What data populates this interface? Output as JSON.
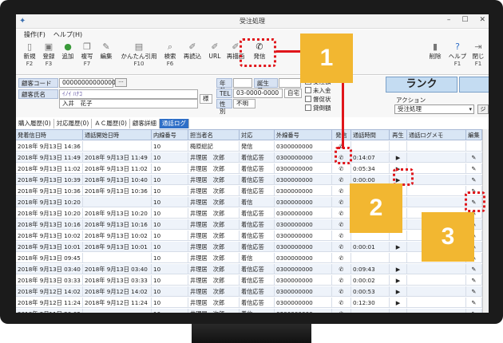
{
  "window": {
    "title": "受注処理",
    "controls": [
      "–",
      "☐",
      "✕"
    ]
  },
  "menu": {
    "items": [
      "操作(F)",
      "ヘルプ(H)"
    ]
  },
  "toolbar": {
    "buttons": [
      {
        "label": "新規",
        "key": "F2",
        "icon": "new-document-icon"
      },
      {
        "label": "登録",
        "key": "F3",
        "icon": "save-icon"
      },
      {
        "label": "追加",
        "key": "",
        "icon": "add-icon"
      },
      {
        "label": "複写",
        "key": "F7",
        "icon": "copy-icon"
      },
      {
        "label": "編集",
        "key": "",
        "icon": "edit-icon"
      },
      {
        "label": "かんたん引用",
        "key": "F10",
        "icon": "quote-icon"
      },
      {
        "label": "検索",
        "key": "F6",
        "icon": "search-icon"
      },
      {
        "label": "再読込",
        "key": "",
        "icon": "reload-icon"
      },
      {
        "label": "URL",
        "key": "",
        "icon": "link-icon"
      },
      {
        "label": "再描画",
        "key": "",
        "icon": "redraw-icon"
      },
      {
        "label": "発信",
        "key": "",
        "icon": "phone-icon"
      },
      {
        "label": "削除",
        "key": "",
        "icon": "delete-icon"
      },
      {
        "label": "ヘルプ",
        "key": "F1",
        "icon": "help-icon"
      },
      {
        "label": "閉じ",
        "key": "F1",
        "icon": "close-icon"
      }
    ]
  },
  "customer": {
    "code_label": "顧客コード",
    "code_value": "000000000000002",
    "code_btn": "···",
    "name_label": "顧客氏名",
    "kana": "ｲﾉｲ ﾊﾅｺ",
    "name": "入井　花子",
    "honorific": "様",
    "age_label": "年齢",
    "birth_label": "誕生月",
    "tel_label": "TEL",
    "tel_value": "03-0000-0000",
    "tel_kind": "自宅",
    "sex_label": "性別",
    "sex_value": "不明",
    "checks": [
      "受注額",
      "未入金",
      "督促状",
      "貸倒額"
    ],
    "rank_label": "ランク",
    "action_label": "アクション",
    "action_value": "受注処理",
    "action_btn": "ジ"
  },
  "tabs": [
    "購入履歴(0)",
    "対応履歴(0)",
    "ＡＣ履歴(0)",
    "顧客詳細",
    "通話ログ"
  ],
  "table": {
    "headers": [
      "発着信日時",
      "通話開始日時",
      "内線番号",
      "担当者名",
      "対応",
      "外線番号",
      "発信",
      "通話時間",
      "再生",
      "通話ログメモ",
      "編集"
    ],
    "rows": [
      [
        "2018年 9月13日 14:36",
        "",
        "10",
        "梅原総記",
        "発信",
        "0300000000",
        "",
        "",
        "",
        "",
        ""
      ],
      [
        "2018年 9月13日 11:49",
        "2018年 9月13日 11:49",
        "10",
        "井理居　次郎",
        "着信応答",
        "0300000000",
        "",
        "0:14:07",
        "▶",
        "",
        "✎"
      ],
      [
        "2018年 9月13日 11:02",
        "2018年 9月13日 11:02",
        "10",
        "井理居　次郎",
        "着信応答",
        "0300000000",
        "",
        "0:05:34",
        "▶",
        "",
        "✎"
      ],
      [
        "2018年 9月13日 10:39",
        "2018年 9月13日 10:40",
        "10",
        "井理居　次郎",
        "着信応答",
        "0300000000",
        "",
        "0:00:00",
        "▶",
        "",
        "✎"
      ],
      [
        "2018年 9月13日 10:36",
        "2018年 9月13日 10:36",
        "10",
        "井理居　次郎",
        "着信応答",
        "0300000000",
        "",
        "",
        "▶",
        "",
        "✎"
      ],
      [
        "2018年 9月13日 10:20",
        "",
        "10",
        "井理居　次郎",
        "着信",
        "0300000000",
        "",
        "",
        "",
        "",
        "✎"
      ],
      [
        "2018年 9月13日 10:20",
        "2018年 9月13日 10:20",
        "10",
        "井理居　次郎",
        "着信応答",
        "0300000000",
        "",
        "",
        "",
        "",
        "✎"
      ],
      [
        "2018年 9月13日 10:16",
        "2018年 9月13日 10:16",
        "10",
        "井理居　次郎",
        "着信応答",
        "0300000000",
        "",
        "",
        "",
        "",
        "✎"
      ],
      [
        "2018年 9月13日 10:02",
        "2018年 9月13日 10:02",
        "10",
        "井理居　次郎",
        "着信応答",
        "0300000000",
        "",
        "",
        "",
        "",
        "✎"
      ],
      [
        "2018年 9月13日 10:01",
        "2018年 9月13日 10:01",
        "10",
        "井理居　次郎",
        "着信応答",
        "0300000000",
        "",
        "0:00:01",
        "▶",
        "",
        "✎"
      ],
      [
        "2018年 9月13日 09:45",
        "",
        "10",
        "井理居　次郎",
        "着信",
        "0300000000",
        "",
        "",
        "",
        "",
        "✎"
      ],
      [
        "2018年 9月13日 03:40",
        "2018年 9月13日 03:40",
        "10",
        "井理居　次郎",
        "着信応答",
        "0300000000",
        "",
        "0:09:43",
        "▶",
        "",
        "✎"
      ],
      [
        "2018年 9月13日 03:33",
        "2018年 9月13日 03:33",
        "10",
        "井理居　次郎",
        "着信応答",
        "0300000000",
        "",
        "0:00:02",
        "▶",
        "",
        "✎"
      ],
      [
        "2018年 9月12日 14:02",
        "2018年 9月12日 14:02",
        "10",
        "井理居　次郎",
        "着信応答",
        "0300000000",
        "",
        "0:00:53",
        "▶",
        "",
        "✎"
      ],
      [
        "2018年 9月12日 11:24",
        "2018年 9月12日 11:24",
        "10",
        "井理居　次郎",
        "着信応答",
        "0300000000",
        "",
        "0:12:30",
        "▶",
        "",
        "✎"
      ],
      [
        "2018年 9月11日 20:02",
        "",
        "10",
        "井理居　次郎",
        "着信",
        "0300000000",
        "",
        "",
        "",
        "",
        "✎"
      ]
    ]
  },
  "callouts": [
    "1",
    "2",
    "3"
  ],
  "colors": {
    "accent": "#2f6fc7",
    "callout": "#f2b731",
    "highlight": "#e0161b"
  }
}
